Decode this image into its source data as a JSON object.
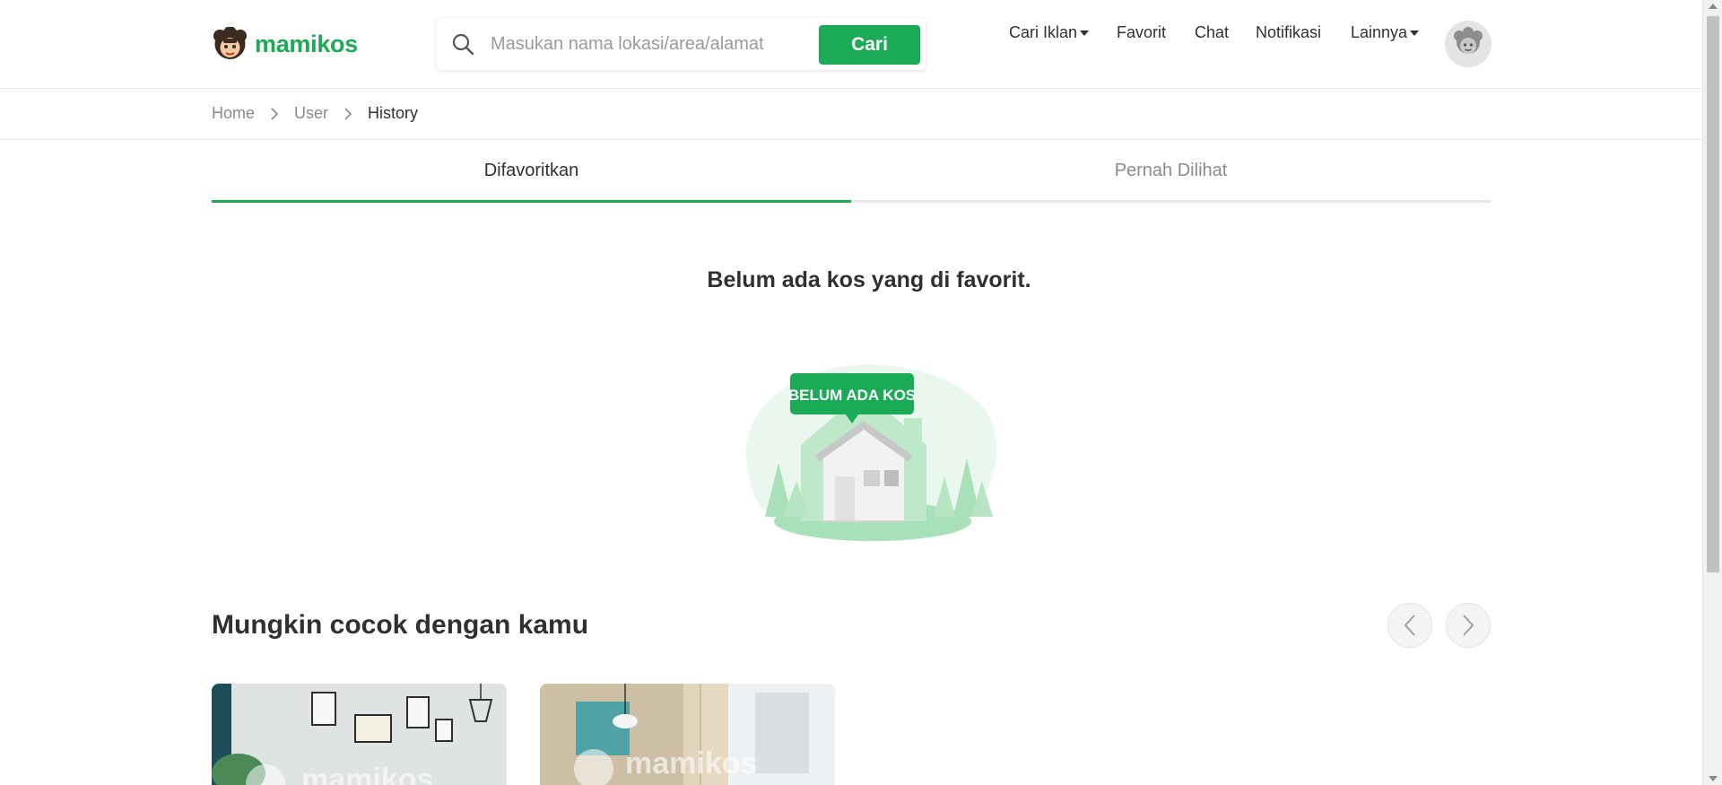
{
  "header": {
    "logo_text": "mamikos",
    "search": {
      "placeholder": "Masukan nama lokasi/area/alamat",
      "value": "",
      "button_label": "Cari"
    },
    "nav": {
      "cari_iklan": "Cari Iklan",
      "favorit": "Favorit",
      "chat": "Chat",
      "notifikasi": "Notifikasi",
      "lainnya": "Lainnya"
    }
  },
  "breadcrumb": {
    "items": [
      "Home",
      "User",
      "History"
    ]
  },
  "tabs": {
    "active": "Difavoritkan",
    "inactive": "Pernah Dilihat"
  },
  "empty_state": {
    "title": "Belum ada kos yang di favorit.",
    "badge_text": "BELUM ADA KOS"
  },
  "recommendations": {
    "title": "Mungkin cocok dengan kamu",
    "card_watermark": "mamikos"
  },
  "colors": {
    "brand_green": "#1baa56",
    "text_dark": "#303030",
    "text_muted": "#8a8a8a"
  },
  "icons": {
    "search": "search-icon",
    "prev": "chevron-left-icon",
    "next": "chevron-right-icon",
    "breadcrumb_sep": "chevron-right-icon"
  }
}
